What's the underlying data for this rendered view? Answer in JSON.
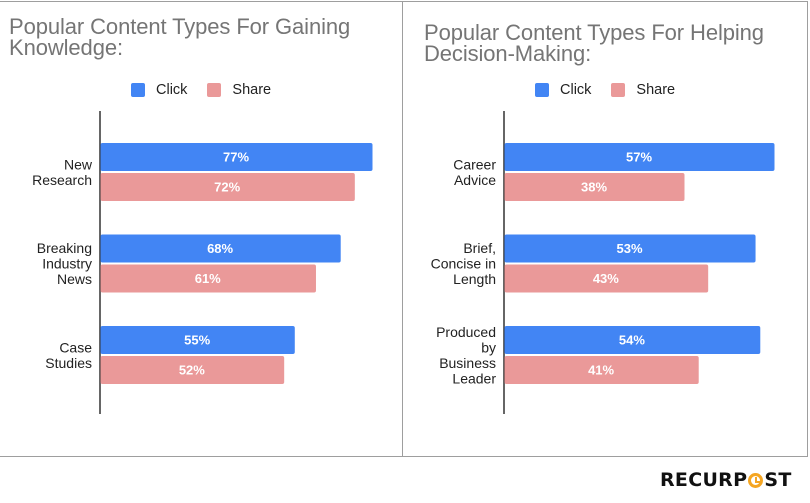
{
  "colors": {
    "click": "#4285f4",
    "share": "#ea9999",
    "axis": "#333333",
    "border": "#9e9e9e"
  },
  "logo": {
    "text_before": "RECURP",
    "text_after": "ST",
    "o_icon": "clock-o-icon",
    "accent": "#f5a623"
  },
  "chart_data": [
    {
      "type": "bar",
      "orientation": "horizontal",
      "title": "Popular Content Types For Gaining\nKnowledge:",
      "categories": [
        "New\nResearch",
        "Breaking\nIndustry\nNews",
        "Case\nStudies"
      ],
      "series": [
        {
          "name": "Click",
          "values": [
            77,
            68,
            55
          ],
          "labels": [
            "77%",
            "68%",
            "55%"
          ]
        },
        {
          "name": "Share",
          "values": [
            72,
            61,
            52
          ],
          "labels": [
            "72%",
            "61%",
            "52%"
          ]
        }
      ],
      "xlim": [
        0,
        77
      ],
      "legend": "top",
      "grid": false,
      "xlabel": "",
      "ylabel": ""
    },
    {
      "type": "bar",
      "orientation": "horizontal",
      "title": "Popular Content Types For Helping\nDecision-Making:",
      "categories": [
        "Career\nAdvice",
        "Brief,\nConcise in\nLength",
        "Produced\nby\nBusiness\nLeader"
      ],
      "series": [
        {
          "name": "Click",
          "values": [
            57,
            53,
            54
          ],
          "labels": [
            "57%",
            "53%",
            "54%"
          ]
        },
        {
          "name": "Share",
          "values": [
            38,
            43,
            41
          ],
          "labels": [
            "38%",
            "43%",
            "41%"
          ]
        }
      ],
      "xlim": [
        0,
        57
      ],
      "legend": "top",
      "grid": false,
      "xlabel": "",
      "ylabel": ""
    }
  ]
}
